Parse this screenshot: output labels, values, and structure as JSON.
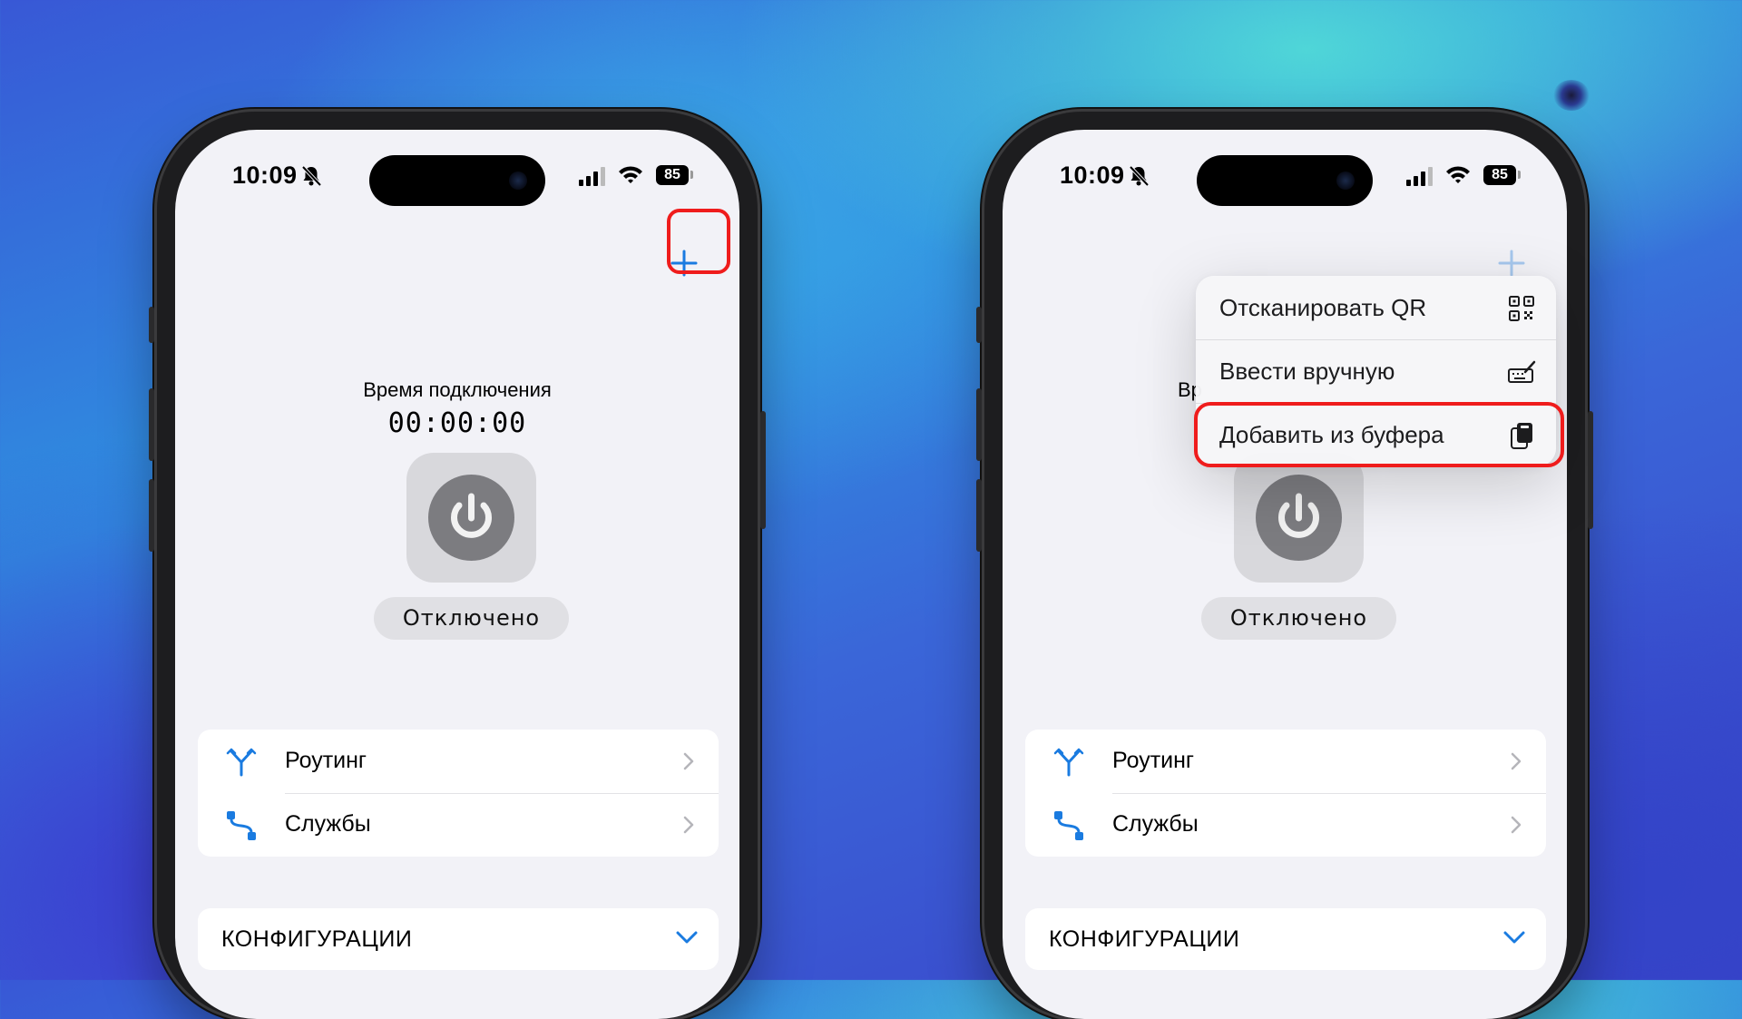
{
  "colors": {
    "accent": "#1a7be0",
    "highlight": "#ef1c1c",
    "power_gray": "#7c7c80"
  },
  "left_phone": {
    "status_bar": {
      "time": "10:09",
      "battery": "85"
    },
    "connection_label": "Время подключения",
    "connection_time": "00:00:00",
    "status": "Отключено",
    "menu": [
      {
        "label": "Роутинг",
        "icon": "routing-icon"
      },
      {
        "label": "Службы",
        "icon": "services-icon"
      }
    ],
    "configs_label": "КОНФИГУРАЦИИ"
  },
  "right_phone": {
    "status_bar": {
      "time": "10:09",
      "battery": "85"
    },
    "connection_label_partial": "Вр",
    "status": "Отключено",
    "menu": [
      {
        "label": "Роутинг",
        "icon": "routing-icon"
      },
      {
        "label": "Службы",
        "icon": "services-icon"
      }
    ],
    "configs_label": "КОНФИГУРАЦИИ",
    "add_menu": [
      {
        "label": "Отсканировать QR",
        "icon": "qr-code-icon"
      },
      {
        "label": "Ввести вручную",
        "icon": "keyboard-pencil-icon"
      },
      {
        "label": "Добавить из буфера",
        "icon": "clipboard-icon"
      }
    ]
  }
}
